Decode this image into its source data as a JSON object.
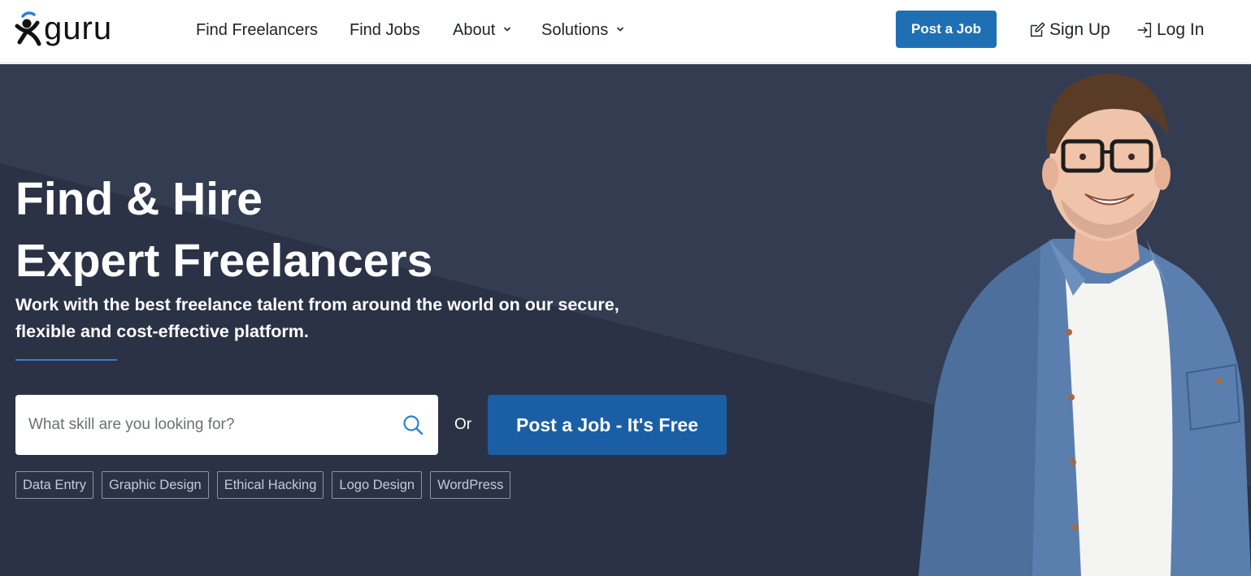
{
  "header": {
    "logo_text": "guru",
    "nav": [
      {
        "label": "Find Freelancers",
        "has_dropdown": false
      },
      {
        "label": "Find Jobs",
        "has_dropdown": false
      },
      {
        "label": "About",
        "has_dropdown": true
      },
      {
        "label": "Solutions",
        "has_dropdown": true
      }
    ],
    "post_job_label": "Post a Job",
    "sign_up_label": "Sign Up",
    "log_in_label": "Log In"
  },
  "hero": {
    "title_line1": "Find & Hire",
    "title_line2": "Expert Freelancers",
    "subtitle_line1": "Work with the best freelance talent from around the world on our secure,",
    "subtitle_line2": "flexible and cost-effective platform.",
    "search_placeholder": "What skill are you looking for?",
    "or_text": "Or",
    "post_job_label": "Post a Job - It's Free",
    "tags": [
      "Data Entry",
      "Graphic Design",
      "Ethical Hacking",
      "Logo Design",
      "WordPress"
    ]
  },
  "icons": {
    "logo": "guru-logo-icon",
    "chevron": "chevron-down-icon",
    "sign_up": "edit-icon",
    "log_in": "login-icon",
    "search": "search-icon"
  },
  "colors": {
    "primary_blue": "#1f6fb5",
    "hero_button_blue": "#1a5fa6",
    "hero_bg": "#343c52",
    "accent_rule": "#3a7ed0"
  }
}
